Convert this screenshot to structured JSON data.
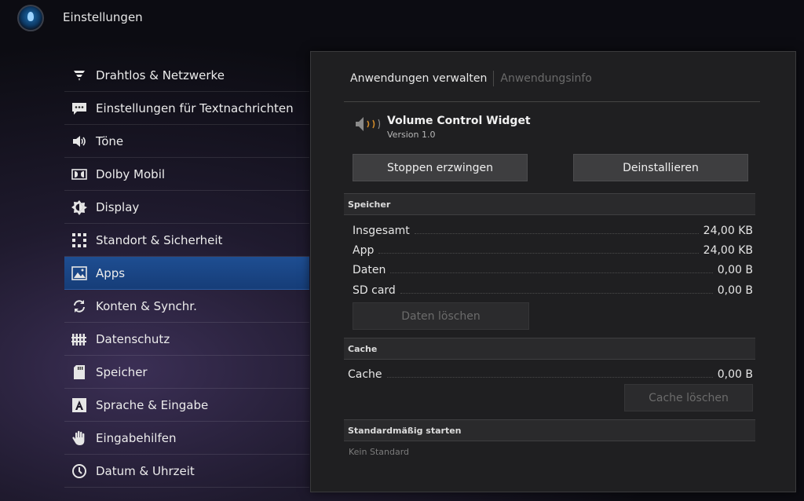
{
  "header": {
    "title": "Einstellungen"
  },
  "sidebar": {
    "items": [
      {
        "label": "Drahtlos & Netzwerke",
        "icon": "wifi-icon"
      },
      {
        "label": "Einstellungen für Textnachrichten",
        "icon": "message-icon"
      },
      {
        "label": "Töne",
        "icon": "speaker-icon"
      },
      {
        "label": "Dolby Mobil",
        "icon": "dolby-icon"
      },
      {
        "label": "Display",
        "icon": "brightness-icon"
      },
      {
        "label": "Standort & Sicherheit",
        "icon": "location-grid-icon"
      },
      {
        "label": "Apps",
        "icon": "apps-image-icon"
      },
      {
        "label": "Konten & Synchr.",
        "icon": "sync-icon"
      },
      {
        "label": "Datenschutz",
        "icon": "privacy-fence-icon"
      },
      {
        "label": "Speicher",
        "icon": "sd-card-icon"
      },
      {
        "label": "Sprache & Eingabe",
        "icon": "keyboard-a-icon"
      },
      {
        "label": "Eingabehilfen",
        "icon": "hand-icon"
      },
      {
        "label": "Datum & Uhrzeit",
        "icon": "clock-icon"
      }
    ]
  },
  "detail": {
    "tabs": [
      "Anwendungen verwalten",
      "Anwendungsinfo"
    ],
    "app": {
      "name": "Volume Control Widget",
      "version": "Version 1.0",
      "icon": "volume-speaker-icon"
    },
    "buttons": {
      "force_stop": "Stoppen erzwingen",
      "uninstall": "Deinstallieren"
    },
    "storage": {
      "title": "Speicher",
      "rows": [
        {
          "label": "Insgesamt",
          "value": "24,00 KB"
        },
        {
          "label": "App",
          "value": "24,00 KB"
        },
        {
          "label": "Daten",
          "value": "0,00 B"
        },
        {
          "label": "SD card",
          "value": "0,00 B"
        }
      ],
      "clear_data": "Daten löschen"
    },
    "cache": {
      "title": "Cache",
      "label": "Cache",
      "value": "0,00 B",
      "clear_cache": "Cache löschen"
    },
    "launch": {
      "title": "Standardmäßig starten",
      "note": "Kein Standard"
    }
  },
  "colors": {
    "active_item": "#1e4e92",
    "panel_bg": "#1f1f21",
    "section_bg": "#2a2a2c"
  }
}
